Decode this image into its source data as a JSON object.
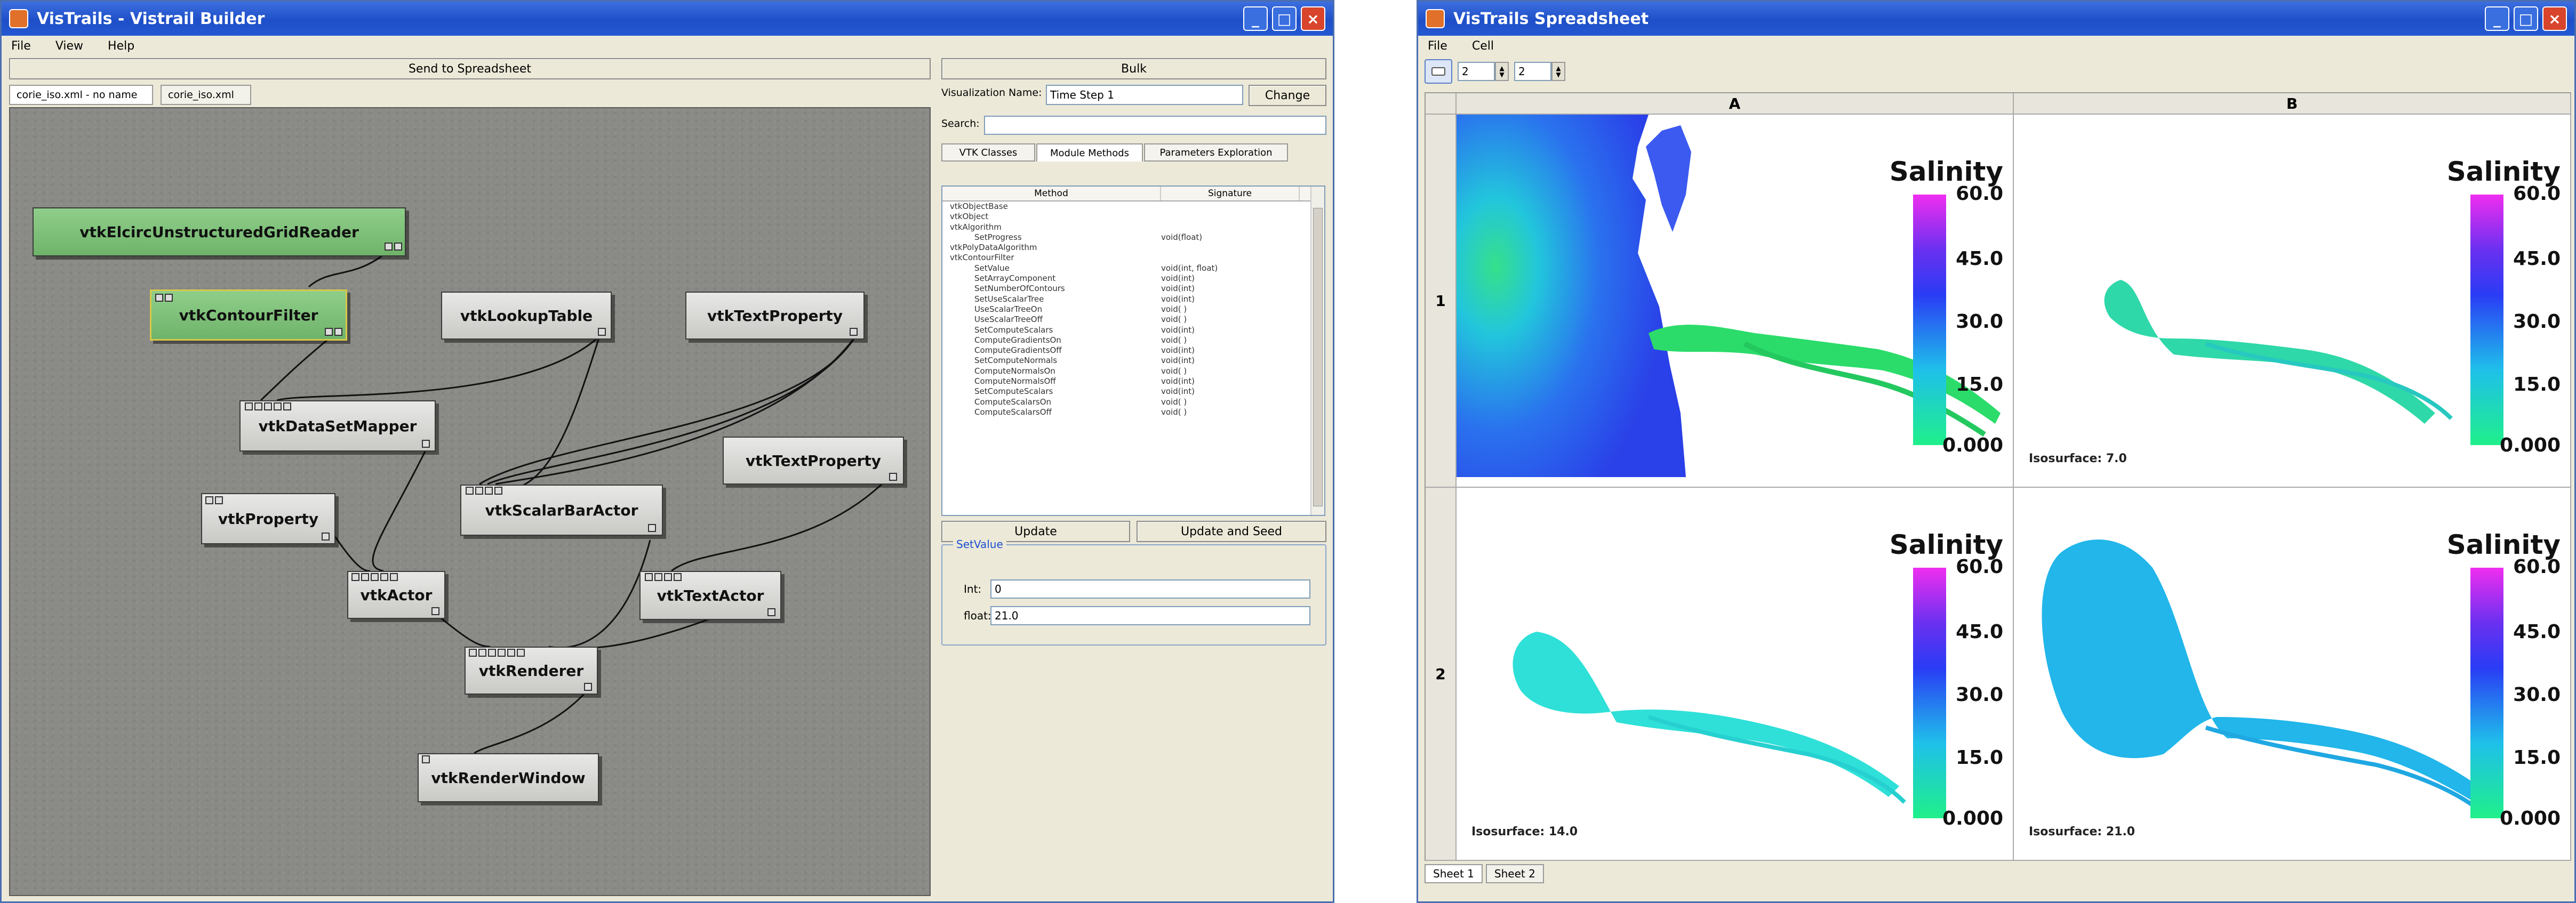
{
  "builder": {
    "title": "VisTrails - Vistrail Builder",
    "menu": [
      "File",
      "View",
      "Help"
    ],
    "send_to_spreadsheet": "Send to Spreadsheet",
    "doc_tabs": [
      "corie_iso.xml - no name",
      "corie_iso.xml"
    ],
    "modules": {
      "reader": "vtkElcircUnstructuredGridReader",
      "contour": "vtkContourFilter",
      "lookup": "vtkLookupTable",
      "textprop1": "vtkTextProperty",
      "mapper": "vtkDataSetMapper",
      "textprop2": "vtkTextProperty",
      "property": "vtkProperty",
      "scalarbar": "vtkScalarBarActor",
      "actor": "vtkActor",
      "textactor": "vtkTextActor",
      "renderer": "vtkRenderer",
      "renderwindow": "vtkRenderWindow"
    },
    "bulk": "Bulk",
    "vis_name_label": "Visualization Name:",
    "vis_name_value": "Time Step 1",
    "change": "Change",
    "search_label": "Search:",
    "tabs": [
      "VTK Classes",
      "Module Methods",
      "Parameters Exploration"
    ],
    "tree_headers": [
      "Method",
      "Signature"
    ],
    "tree_rows": [
      {
        "m": "vtkObjectBase",
        "s": ""
      },
      {
        "m": "vtkObject",
        "s": ""
      },
      {
        "m": "vtkAlgorithm",
        "s": ""
      },
      {
        "m": "SetProgress",
        "s": "void(float)"
      },
      {
        "m": "vtkPolyDataAlgorithm",
        "s": ""
      },
      {
        "m": "vtkContourFilter",
        "s": ""
      },
      {
        "m": "SetValue",
        "s": "void(int, float)"
      },
      {
        "m": "SetArrayComponent",
        "s": "void(int)"
      },
      {
        "m": "SetNumberOfContours",
        "s": "void(int)"
      },
      {
        "m": "SetUseScalarTree",
        "s": "void(int)"
      },
      {
        "m": "UseScalarTreeOn",
        "s": "void( )"
      },
      {
        "m": "UseScalarTreeOff",
        "s": "void( )"
      },
      {
        "m": "SetComputeScalars",
        "s": "void(int)"
      },
      {
        "m": "ComputeGradientsOn",
        "s": "void( )"
      },
      {
        "m": "ComputeGradientsOff",
        "s": "void(int)"
      },
      {
        "m": "SetComputeNormals",
        "s": "void(int)"
      },
      {
        "m": "ComputeNormalsOn",
        "s": "void( )"
      },
      {
        "m": "ComputeNormalsOff",
        "s": "void(int)"
      },
      {
        "m": "SetComputeScalars",
        "s": "void(int)"
      },
      {
        "m": "ComputeScalarsOn",
        "s": "void( )"
      },
      {
        "m": "ComputeScalarsOff",
        "s": "void( )"
      }
    ],
    "update": "Update",
    "update_seed": "Update and Seed",
    "setvalue": {
      "legend": "SetValue",
      "int_label": "Int:",
      "int_value": "0",
      "float_label": "float:",
      "float_value": "21.0"
    }
  },
  "spreadsheet": {
    "title": "VisTrails Spreadsheet",
    "menu": [
      "File",
      "Cell"
    ],
    "rows_value": "2",
    "cols_value": "2",
    "col_headers": [
      "A",
      "B"
    ],
    "row_headers": [
      "1",
      "2"
    ],
    "legend_title": "Salinity",
    "legend_ticks": [
      "60.0",
      "45.0",
      "30.0",
      "15.0",
      "0.000"
    ],
    "isosurface_labels": [
      "Isosurface: 7.0",
      "Isosurface: 14.0",
      "Isosurface: 21.0"
    ],
    "sheet_tabs": [
      "Sheet 1",
      "Sheet 2"
    ]
  }
}
